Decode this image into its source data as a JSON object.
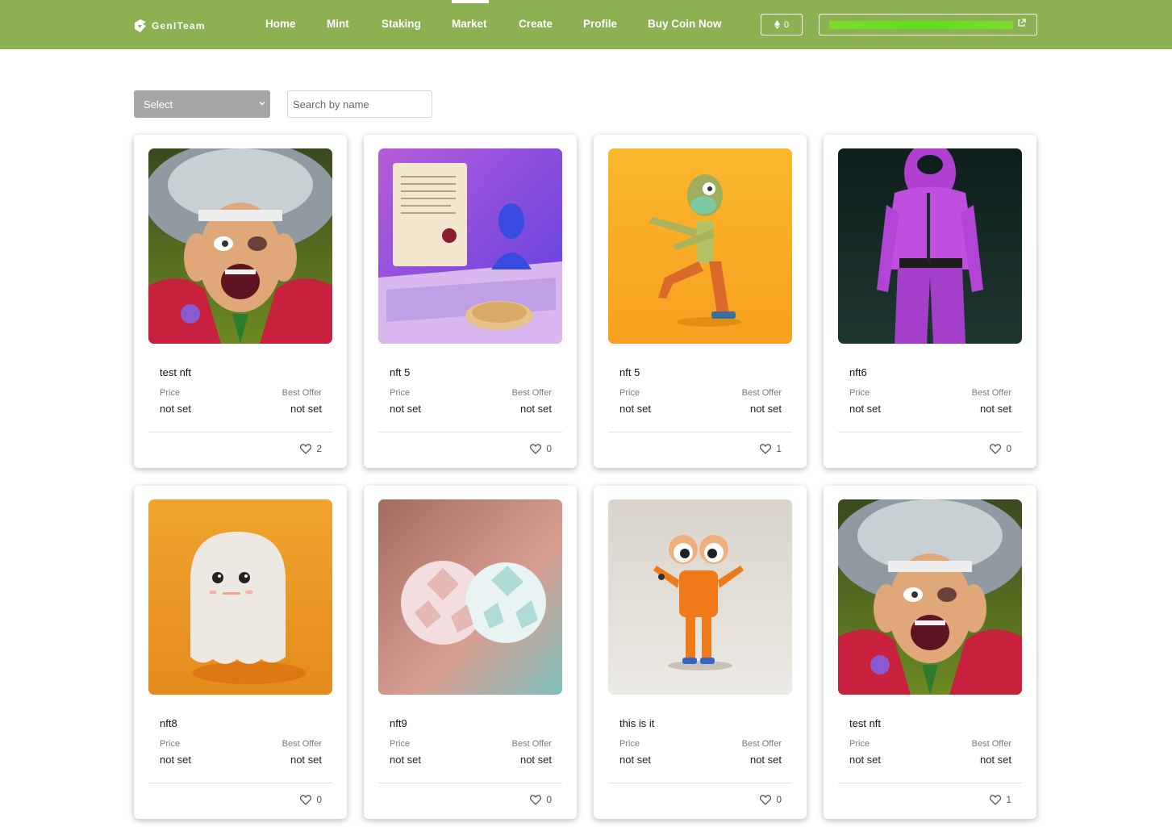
{
  "header": {
    "brand": "GenITeam",
    "nav": [
      "Home",
      "Mint",
      "Staking",
      "Market",
      "Create",
      "Profile",
      "Buy Coin Now"
    ],
    "active_nav": "Market",
    "balance": "0",
    "colors": {
      "topbar": "#8bb152",
      "wallet_highlight": "#66dd22"
    }
  },
  "filters": {
    "select_value": "Select",
    "search_placeholder": "Search by name"
  },
  "labels": {
    "price": "Price",
    "best_offer": "Best Offer"
  },
  "cards": [
    {
      "title": "test nft",
      "price": "not set",
      "best_offer": "not set",
      "likes": "2",
      "image": "screaming-man"
    },
    {
      "title": "nft 5",
      "price": "not set",
      "best_offer": "not set",
      "likes": "0",
      "image": "laptop-scroll-bust"
    },
    {
      "title": "nft 5",
      "price": "not set",
      "best_offer": "not set",
      "likes": "1",
      "image": "masked-zombie"
    },
    {
      "title": "nft6",
      "price": "not set",
      "best_offer": "not set",
      "likes": "0",
      "image": "pink-tracksuit"
    },
    {
      "title": "nft8",
      "price": "not set",
      "best_offer": "not set",
      "likes": "0",
      "image": "ghost"
    },
    {
      "title": "nft9",
      "price": "not set",
      "best_offer": "not set",
      "likes": "0",
      "image": "paper-polyhedra"
    },
    {
      "title": "this is it",
      "price": "not set",
      "best_offer": "not set",
      "likes": "0",
      "image": "googly-eye-creature"
    },
    {
      "title": "test nft",
      "price": "not set",
      "best_offer": "not set",
      "likes": "1",
      "image": "screaming-man"
    }
  ]
}
